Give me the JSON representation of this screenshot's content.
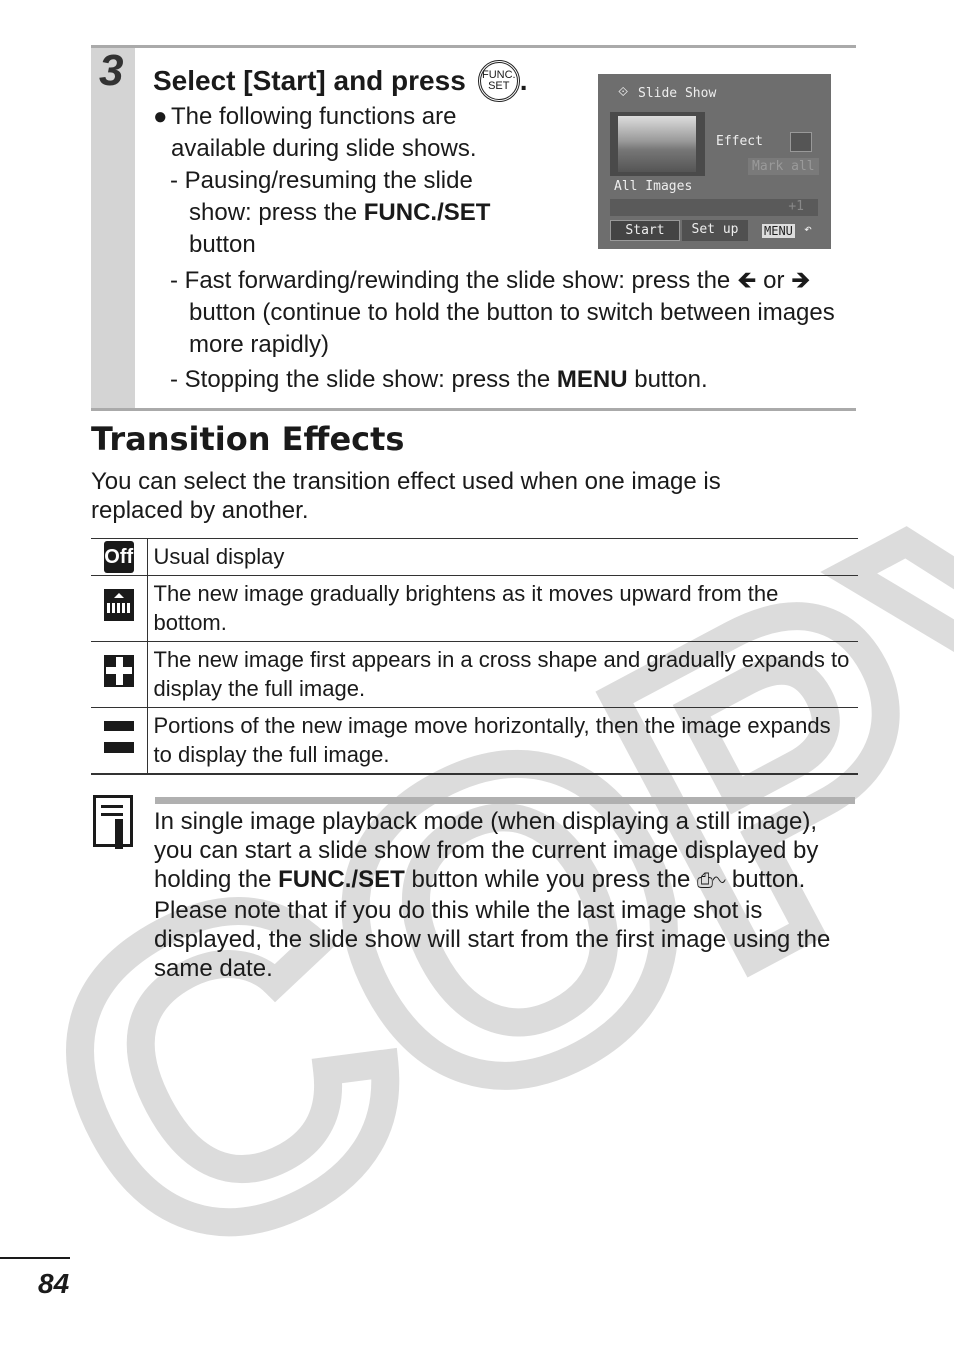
{
  "watermark": {
    "text": "COPY",
    "color": "#d8d8d8"
  },
  "step": {
    "number": "3",
    "title": "Select [Start] and press",
    "title_icon_top": "FUNC.",
    "title_icon_bottom": "SET",
    "title_end": ".",
    "bullet": "The following functions are available during slide shows.",
    "items": [
      {
        "pre": "- Pausing/resuming the slide show: press the ",
        "bold": "FUNC./SET",
        "post": " button"
      },
      {
        "pre": "- Fast forwarding/rewinding the slide show: press the ",
        "mid": " or ",
        "post": " button (continue to hold the button to switch between images more rapidly)"
      },
      {
        "pre": "- Stopping the slide show: press the ",
        "bold": "MENU",
        "post": " button."
      }
    ]
  },
  "lcd": {
    "title": "Slide Show",
    "effect": "Effect",
    "mark_all": "Mark all",
    "all_images": "All Images",
    "start": "Start",
    "setup": "Set up",
    "menu": "MENU",
    "plus1": "+1"
  },
  "section": {
    "title": "Transition Effects",
    "intro": "You can select the transition effect used when one image is replaced by another.",
    "rows": [
      {
        "icon": "off-icon",
        "icon_text": "Off",
        "text": "Usual display"
      },
      {
        "icon": "brighten-upward-icon",
        "text": "The new image gradually brightens as it moves upward from the bottom."
      },
      {
        "icon": "cross-icon",
        "text": "The new image first appears in a cross shape and gradually expands to display the full image."
      },
      {
        "icon": "horizontal-band-icon",
        "text": "Portions of the new image move horizontally, then the image expands to display the full image."
      }
    ]
  },
  "note": {
    "pre": "In single image playback mode (when displaying a still image), you can start a slide show from the current image displayed by holding the ",
    "bold": "FUNC./SET",
    "mid": " button while you press the ",
    "post": " button. Please note that if you do this while the last image shot is displayed, the slide show will start from the first image using the same date."
  },
  "page_number": "84"
}
